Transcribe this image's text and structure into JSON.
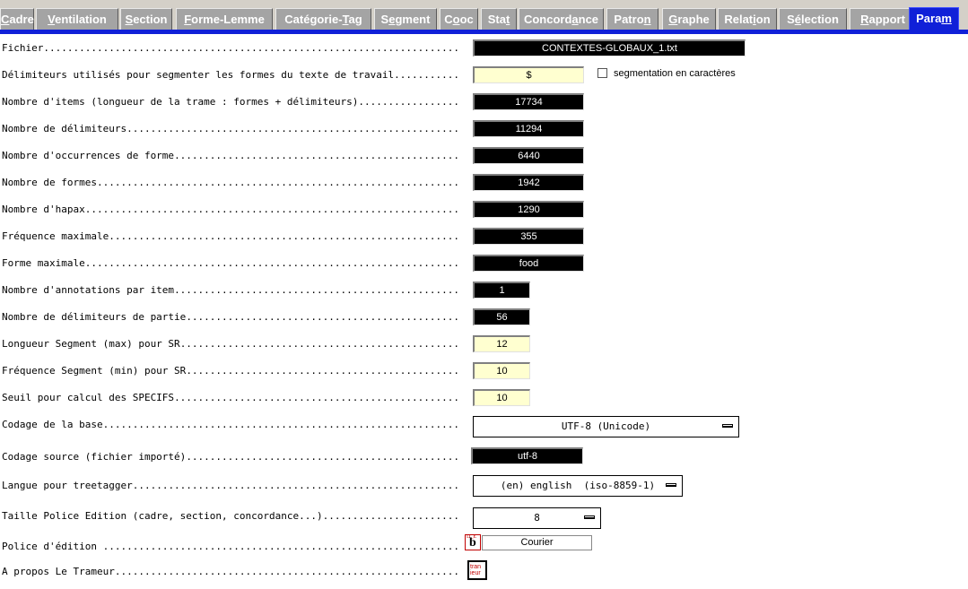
{
  "tabs": [
    {
      "pre": "",
      "ul": "C",
      "post": "adre",
      "active": false
    },
    {
      "pre": "",
      "ul": "V",
      "post": "entilation",
      "active": false
    },
    {
      "pre": "",
      "ul": "S",
      "post": "ection",
      "active": false
    },
    {
      "pre": "",
      "ul": "F",
      "post": "orme-Lemme",
      "active": false
    },
    {
      "pre": "Catégorie-",
      "ul": "T",
      "post": "ag",
      "active": false
    },
    {
      "pre": "S",
      "ul": "e",
      "post": "gment",
      "active": false
    },
    {
      "pre": "C",
      "ul": "o",
      "post": "oc",
      "active": false
    },
    {
      "pre": "Sta",
      "ul": "t",
      "post": "",
      "active": false
    },
    {
      "pre": "Concord",
      "ul": "a",
      "post": "nce",
      "active": false
    },
    {
      "pre": "Patro",
      "ul": "n",
      "post": "",
      "active": false
    },
    {
      "pre": "",
      "ul": "G",
      "post": "raphe",
      "active": false
    },
    {
      "pre": "Relat",
      "ul": "i",
      "post": "on",
      "active": false
    },
    {
      "pre": "S",
      "ul": "é",
      "post": "lection",
      "active": false
    },
    {
      "pre": "",
      "ul": "R",
      "post": "apport",
      "active": false
    },
    {
      "pre": "Para",
      "ul": "m",
      "post": "",
      "active": true
    }
  ],
  "params": {
    "fichier": {
      "label": "Fichier",
      "value": "CONTEXTES-GLOBAUX_1.txt"
    },
    "delimiteurs": {
      "label": "Délimiteurs utilisés pour segmenter les formes du texte de travail",
      "value": "$"
    },
    "segmentation_label": "segmentation en caractères",
    "nb_items": {
      "label": "Nombre d'items (longueur de la trame : formes + délimiteurs)",
      "value": "17734"
    },
    "nb_delimiteurs": {
      "label": "Nombre de délimiteurs",
      "value": "11294"
    },
    "nb_occurrences": {
      "label": "Nombre d'occurrences de forme",
      "value": "6440"
    },
    "nb_formes": {
      "label": "Nombre de formes",
      "value": "1942"
    },
    "nb_hapax": {
      "label": "Nombre d'hapax",
      "value": "1290"
    },
    "freq_max": {
      "label": "Fréquence maximale",
      "value": "355"
    },
    "forme_max": {
      "label": "Forme maximale",
      "value": "food"
    },
    "nb_annotations": {
      "label": "Nombre d'annotations par item",
      "value": "1"
    },
    "nb_delim_partie": {
      "label": "Nombre de délimiteurs de partie",
      "value": "56"
    },
    "longueur_segment": {
      "label": "Longueur Segment (max) pour SR",
      "value": "12"
    },
    "freq_segment": {
      "label": "Fréquence Segment (min) pour SR",
      "value": "10"
    },
    "seuil_specifs": {
      "label": "Seuil pour calcul des SPECIFS",
      "value": "10"
    },
    "codage_base": {
      "label": "Codage de la base",
      "value": "UTF-8 (Unicode)"
    },
    "codage_source": {
      "label": "Codage source (fichier importé)",
      "value": "utf-8"
    },
    "langue_treetagger": {
      "label": "Langue pour treetagger",
      "value": "(en) english  (iso-8859-1)"
    },
    "taille_police": {
      "label": "Taille Police Edition (cadre, section, concordance...)",
      "value": "8"
    },
    "police_edition": {
      "label": "Police d'édition ",
      "value": "Courier"
    },
    "a_propos": {
      "label": "A propos Le Trameur"
    }
  },
  "icons": {
    "font_button": "font-picker-icon",
    "about_button": "trameur-logo-icon",
    "font_icon_small": "D_E",
    "font_icon_big": "b",
    "about_icon_line1": "tran",
    "about_icon_line2": "ieur"
  },
  "colors": {
    "tab_active": "#1020d8",
    "tab_inactive": "#a4a4a4",
    "input_bg": "#ffffd0",
    "dark_field": "#000000"
  }
}
